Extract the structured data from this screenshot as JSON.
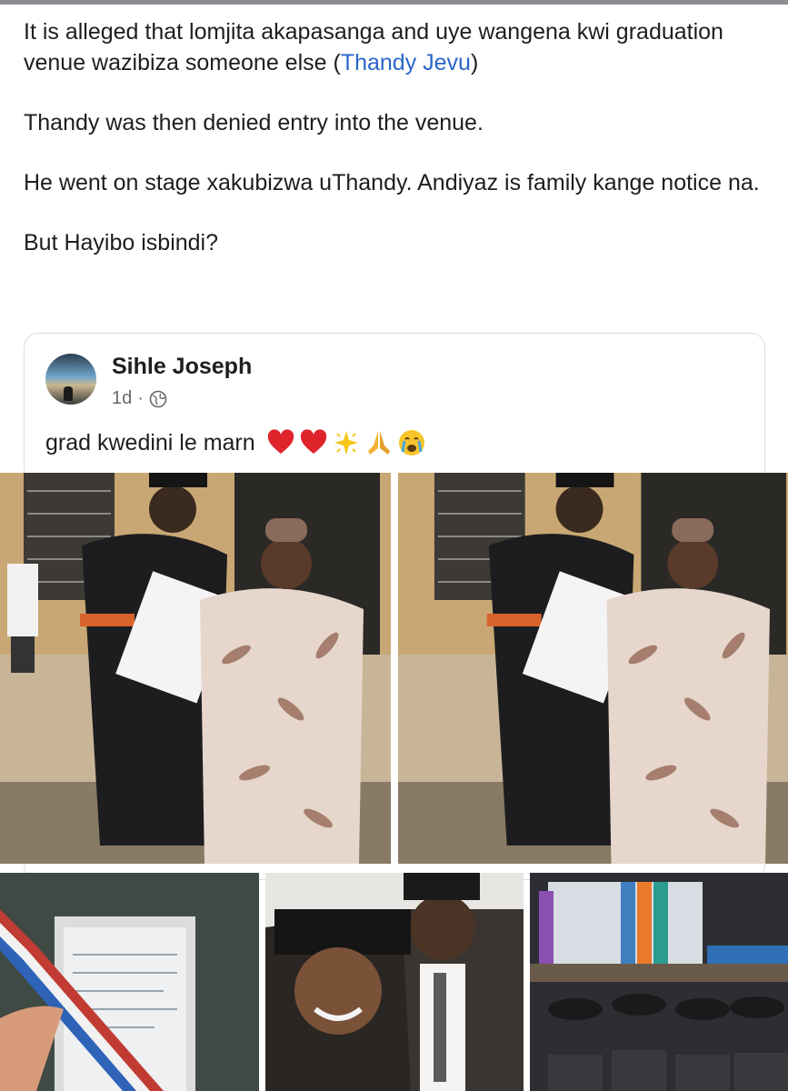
{
  "post": {
    "paragraphs": [
      {
        "before": "It is alleged that lomjita akapasanga and uye wangena kwi graduation venue wazibiza someone else (",
        "mention": "Thandy Jevu",
        "after": ")"
      },
      {
        "before": "Thandy was then denied entry into the venue.",
        "mention": "",
        "after": ""
      },
      {
        "before": "He went on stage xakubizwa uThandy. Andiyaz is family kange notice na.",
        "mention": "",
        "after": ""
      },
      {
        "before": "But Hayibo isbindi?",
        "mention": "",
        "after": ""
      }
    ]
  },
  "shared_post": {
    "author": "Sihle Joseph",
    "time": "1d",
    "separator": "·",
    "caption": "grad kwedini le marn",
    "emojis": [
      "heart-emoji",
      "heart-emoji",
      "sparkle-emoji",
      "praying-hands-emoji",
      "crying-emoji"
    ]
  },
  "colors": {
    "mention": "#2a66c9",
    "meta": "#65676b",
    "card_border": "#dadde1"
  }
}
